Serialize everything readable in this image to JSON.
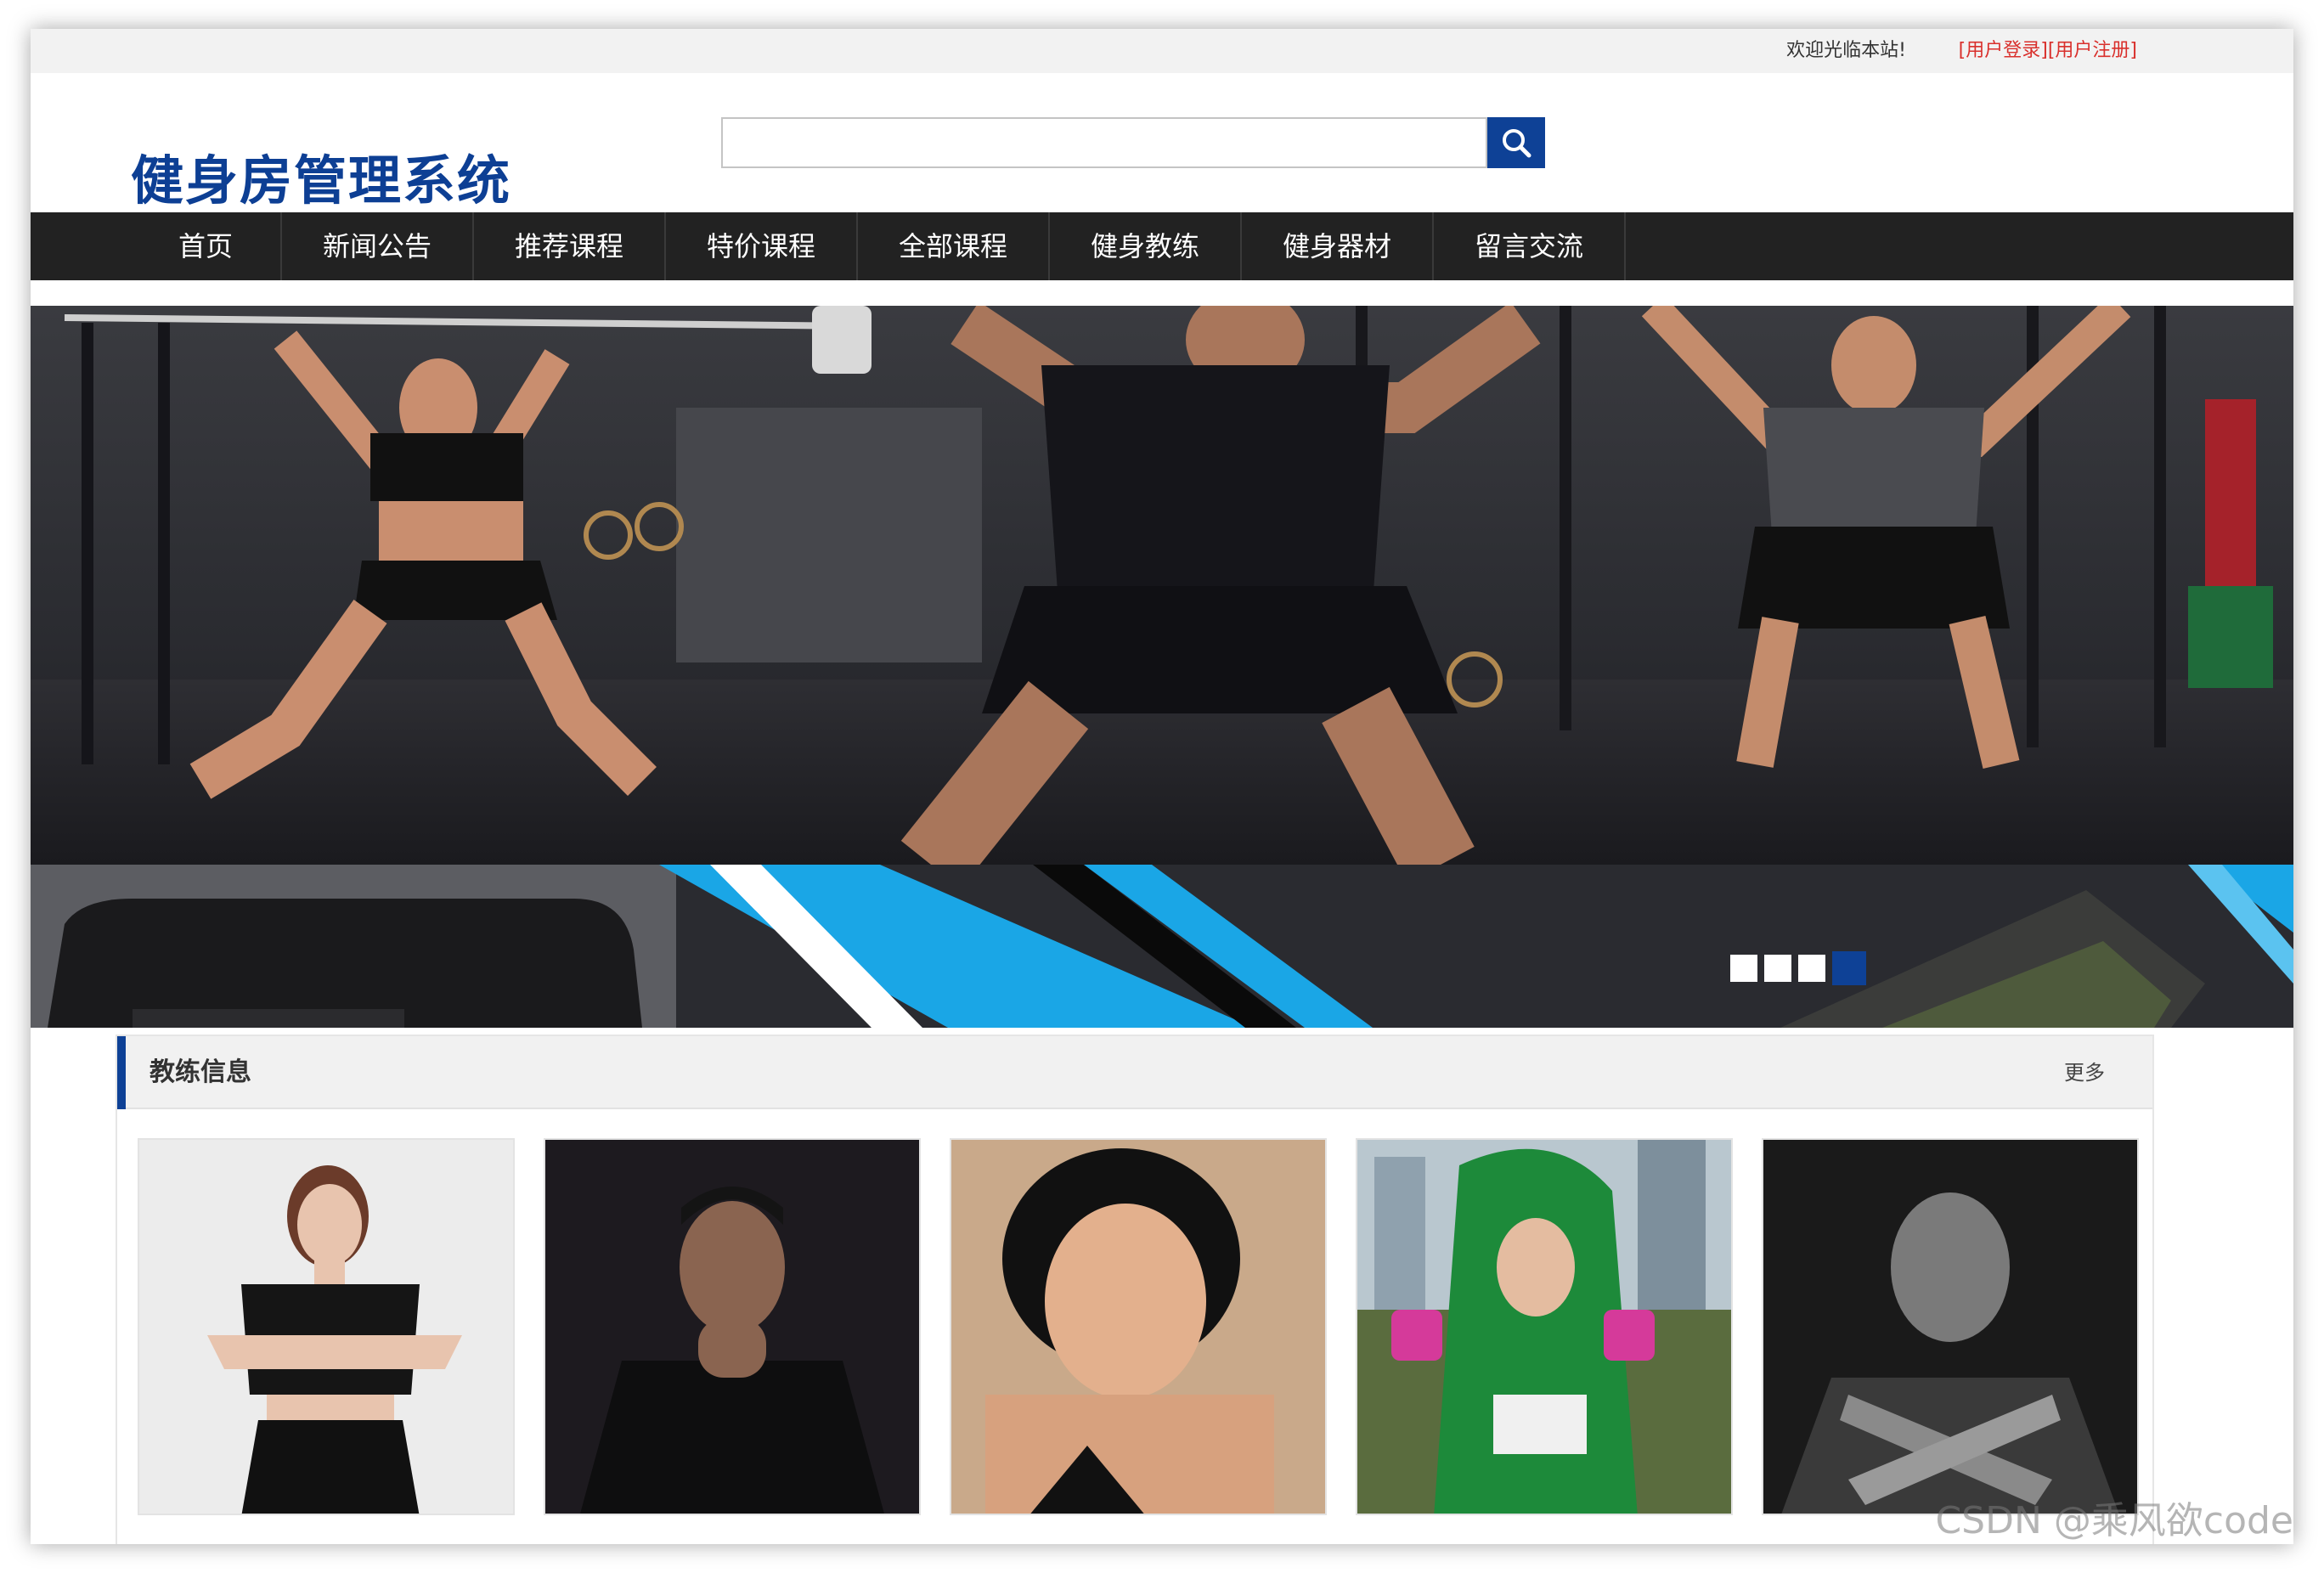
{
  "topbar": {
    "welcome": "欢迎光临本站!",
    "login": "[用户登录]",
    "register": "[用户注册]"
  },
  "header": {
    "logo": "健身房管理系统",
    "search_placeholder": ""
  },
  "nav": {
    "items": [
      "首页",
      "新闻公告",
      "推荐课程",
      "特价课程",
      "全部课程",
      "健身教练",
      "健身器材",
      "留言交流"
    ]
  },
  "banner": {
    "slide_count": 4,
    "active_slide": 4
  },
  "coaches": {
    "title": "教练信息",
    "more": "更多",
    "cards": [
      {
        "name": "coach-photo-1"
      },
      {
        "name": "coach-photo-2"
      },
      {
        "name": "coach-photo-3"
      },
      {
        "name": "coach-photo-4"
      },
      {
        "name": "coach-photo-5"
      }
    ]
  },
  "watermark": "CSDN @乘风欲code",
  "colors": {
    "brand_blue": "#0e4196",
    "nav_bg": "#222222",
    "auth_red": "#d9302c"
  }
}
